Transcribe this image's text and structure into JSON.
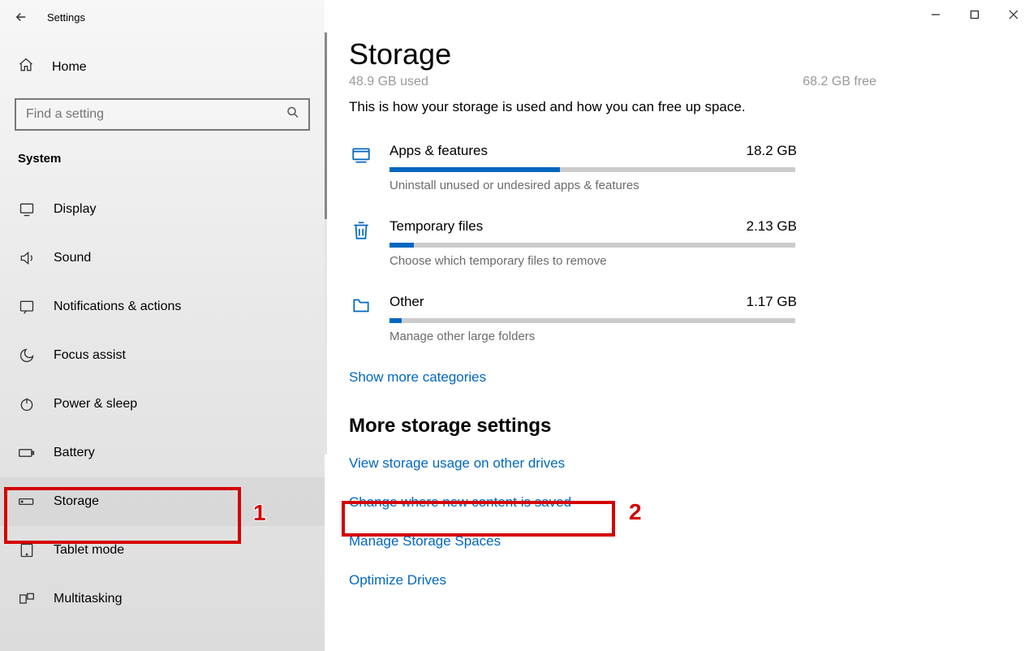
{
  "window": {
    "title": "Settings"
  },
  "sidebar": {
    "home": "Home",
    "search_placeholder": "Find a setting",
    "section": "System",
    "items": [
      {
        "label": "Display"
      },
      {
        "label": "Sound"
      },
      {
        "label": "Notifications & actions"
      },
      {
        "label": "Focus assist"
      },
      {
        "label": "Power & sleep"
      },
      {
        "label": "Battery"
      },
      {
        "label": "Storage"
      },
      {
        "label": "Tablet mode"
      },
      {
        "label": "Multitasking"
      }
    ]
  },
  "page": {
    "title": "Storage",
    "usage_used": "48.9 GB used",
    "usage_free": "68.2 GB free",
    "description": "This is how your storage is used and how you can free up space.",
    "categories": [
      {
        "name": "Apps & features",
        "size": "18.2 GB",
        "percent": 42,
        "sub": "Uninstall unused or undesired apps & features"
      },
      {
        "name": "Temporary files",
        "size": "2.13 GB",
        "percent": 6,
        "sub": "Choose which temporary files to remove"
      },
      {
        "name": "Other",
        "size": "1.17 GB",
        "percent": 3,
        "sub": "Manage other large folders"
      }
    ],
    "show_more": "Show more categories",
    "more_header": "More storage settings",
    "links": [
      "View storage usage on other drives",
      "Change where new content is saved",
      "Manage Storage Spaces",
      "Optimize Drives"
    ]
  },
  "annotations": {
    "n1": "1",
    "n2": "2"
  }
}
